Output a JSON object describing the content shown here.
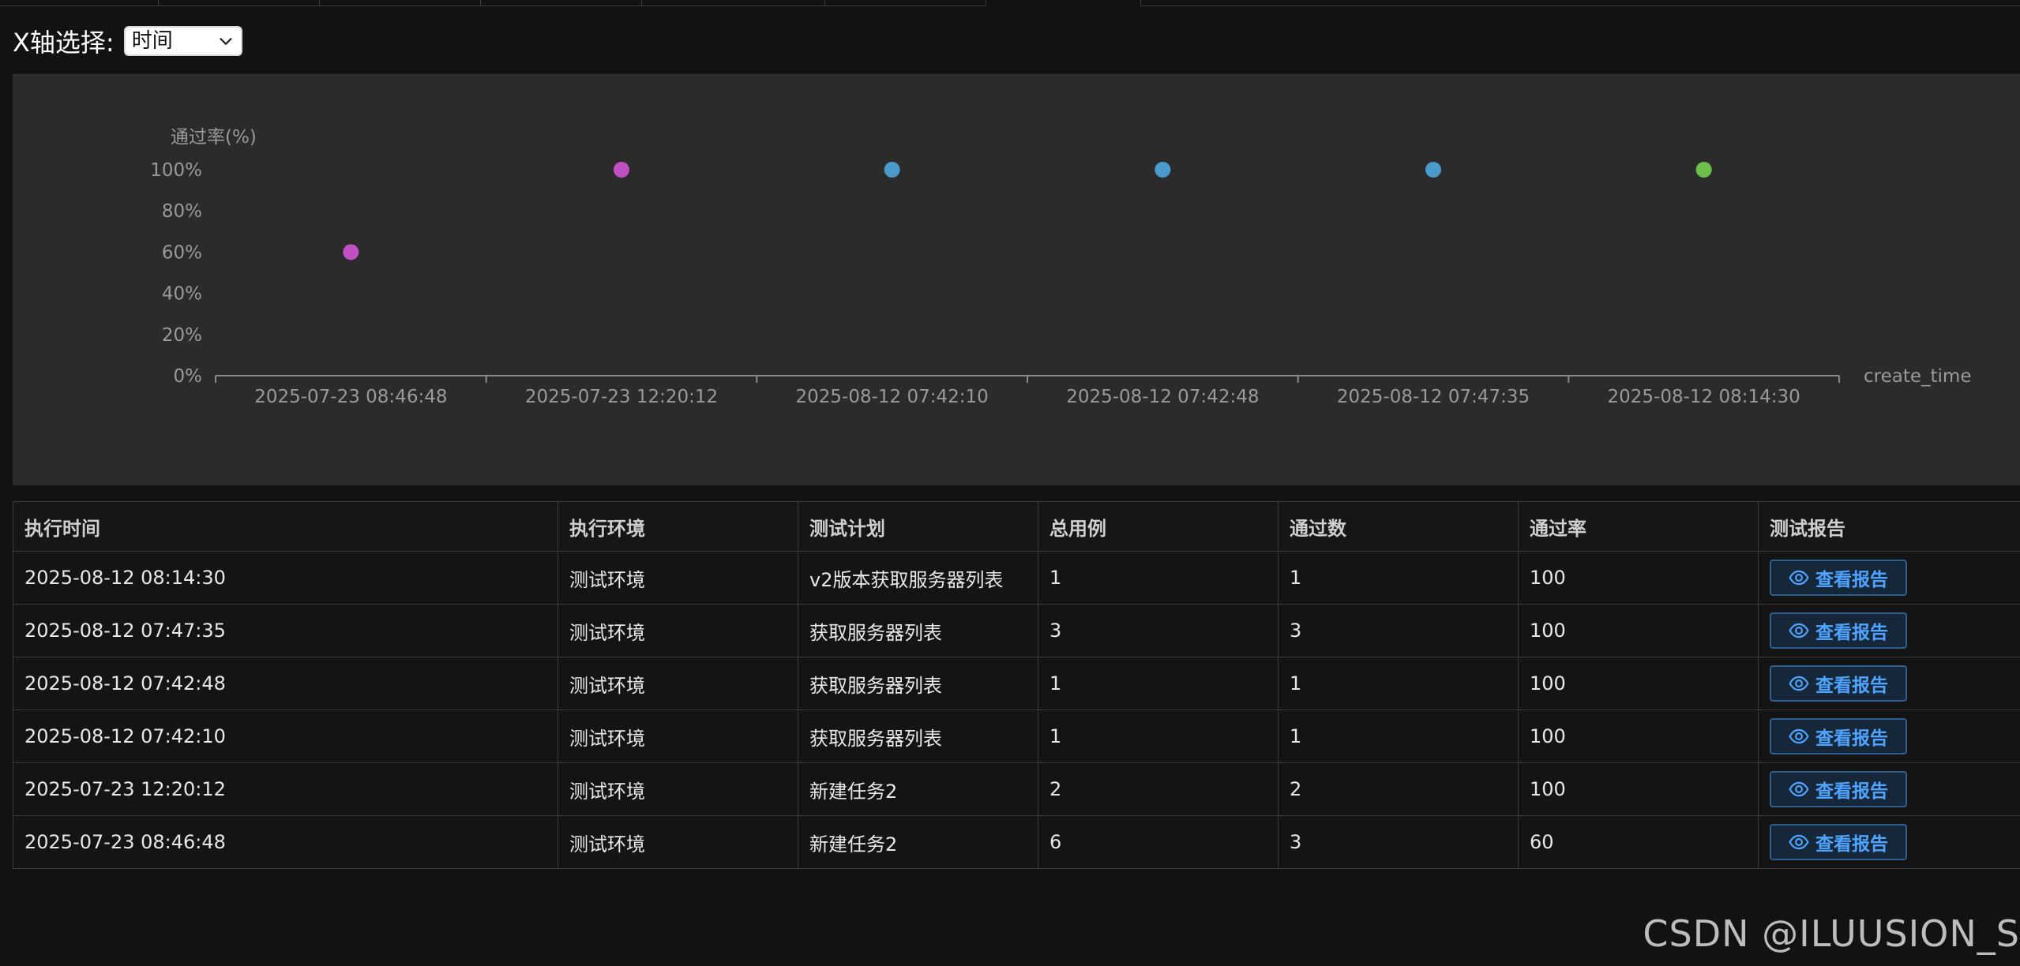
{
  "xaxis_selector": {
    "label": "X轴选择:",
    "selected": "时间"
  },
  "chart_data": {
    "type": "scatter",
    "ylabel": "通过率(%)",
    "xlabel": "create_time",
    "y_ticks": [
      "0%",
      "20%",
      "40%",
      "60%",
      "80%",
      "100%"
    ],
    "ylim": [
      0,
      100
    ],
    "categories": [
      "2025-07-23 08:46:48",
      "2025-07-23 12:20:12",
      "2025-08-12 07:42:10",
      "2025-08-12 07:42:48",
      "2025-08-12 07:47:35",
      "2025-08-12 08:14:30"
    ],
    "values": [
      60,
      100,
      100,
      100,
      100,
      100
    ],
    "point_colors": [
      "#c150c3",
      "#c150c3",
      "#4a9acb",
      "#4a9acb",
      "#4a9acb",
      "#6bbf4a"
    ],
    "grid": false
  },
  "table": {
    "headers": [
      "执行时间",
      "执行环境",
      "测试计划",
      "总用例",
      "通过数",
      "通过率",
      "测试报告"
    ],
    "button_label": "查看报告",
    "rows": [
      [
        "2025-08-12 08:14:30",
        "测试环境",
        "v2版本获取服务器列表",
        "1",
        "1",
        "100"
      ],
      [
        "2025-08-12 07:47:35",
        "测试环境",
        "获取服务器列表",
        "3",
        "3",
        "100"
      ],
      [
        "2025-08-12 07:42:48",
        "测试环境",
        "获取服务器列表",
        "1",
        "1",
        "100"
      ],
      [
        "2025-08-12 07:42:10",
        "测试环境",
        "获取服务器列表",
        "1",
        "1",
        "100"
      ],
      [
        "2025-07-23 12:20:12",
        "测试环境",
        "新建任务2",
        "2",
        "2",
        "100"
      ],
      [
        "2025-07-23 08:46:48",
        "测试环境",
        "新建任务2",
        "6",
        "3",
        "60"
      ]
    ]
  },
  "watermark": "CSDN @ILUUSION_S",
  "colors": {
    "background": "#121212",
    "panel": "#2b2b2b",
    "accent": "#4ea4ff"
  }
}
